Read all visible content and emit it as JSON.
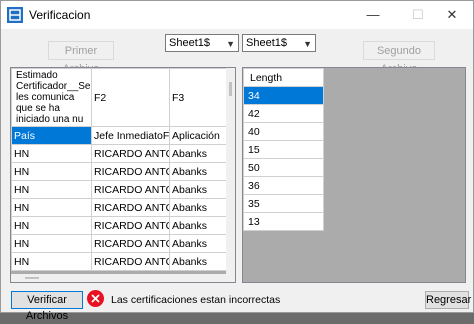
{
  "window": {
    "title": "Verificacion",
    "minimize": "—",
    "maximize": "☐",
    "close": "✕"
  },
  "toolbar": {
    "primer_archivo": "Primer Archivo",
    "segundo_archivo": "Segundo Archivo",
    "sheet_left": "Sheet1$",
    "sheet_right": "Sheet1$"
  },
  "left_grid": {
    "headers": [
      "Estimado Certificador__Se les comunica que se ha iniciado una nu",
      "F2",
      "F3"
    ],
    "rows": [
      [
        "País",
        "Jefe InmediatoFu...",
        "Aplicación"
      ],
      [
        "HN",
        "RICARDO ANTO...",
        "Abanks"
      ],
      [
        "HN",
        "RICARDO ANTO...",
        "Abanks"
      ],
      [
        "HN",
        "RICARDO ANTO...",
        "Abanks"
      ],
      [
        "HN",
        "RICARDO ANTO...",
        "Abanks"
      ],
      [
        "HN",
        "RICARDO ANTO...",
        "Abanks"
      ],
      [
        "HN",
        "RICARDO ANTO...",
        "Abanks"
      ],
      [
        "HN",
        "RICARDO ANTO...",
        "Abanks"
      ]
    ]
  },
  "right_grid": {
    "header": "Length",
    "rows": [
      "34",
      "42",
      "40",
      "15",
      "50",
      "36",
      "35",
      "13"
    ]
  },
  "bottom": {
    "verify_button": "Verificar Archivos",
    "status_text": "Las certificaciones estan incorrectas",
    "back_button": "Regresar"
  },
  "colors": {
    "selection": "#0078d7",
    "error": "#e81123"
  }
}
